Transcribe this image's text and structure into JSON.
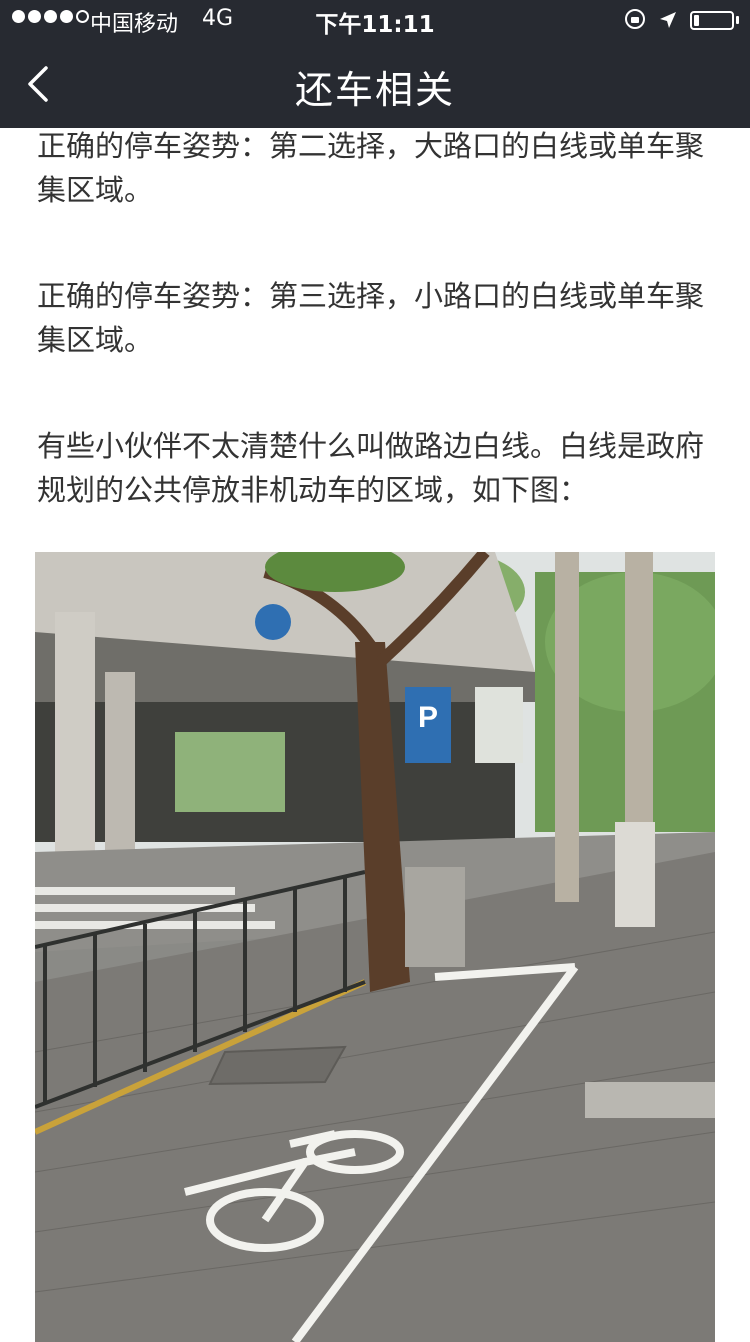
{
  "status_bar": {
    "signal_filled": 4,
    "signal_total": 5,
    "carrier": "中国移动",
    "network": "4G",
    "time": "下午11:11",
    "battery_level": 0.15
  },
  "nav": {
    "back_icon": "chevron-left-icon",
    "title": "还车相关"
  },
  "article": {
    "paragraphs": [
      "正确的停车姿势：第二选择，大路口的白线或单车聚集区域。",
      "正确的停车姿势：第三选择，小路口的白线或单车聚集区域。",
      "有些小伙伴不太清楚什么叫做路边白线。白线是政府规划的公共停放非机动车的区域，如下图："
    ],
    "photo_sign_text": "P"
  },
  "colors": {
    "header_bg": "#272a31",
    "text": "#333333",
    "background": "#ffffff"
  }
}
